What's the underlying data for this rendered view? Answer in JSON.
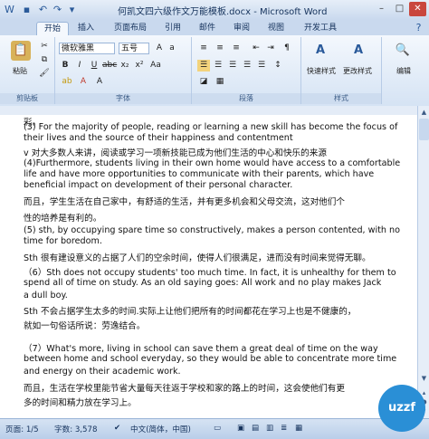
{
  "window": {
    "title": "何凯文四六级作文万能模板.docx - Microsoft Word"
  },
  "tabs": [
    "开始",
    "插入",
    "页面布局",
    "引用",
    "邮件",
    "审阅",
    "视图",
    "开发工具"
  ],
  "ribbon": {
    "clipboard": {
      "label": "剪贴板",
      "paste": "粘贴"
    },
    "font": {
      "label": "字体",
      "font_name": "微软雅黑",
      "font_size": "五号"
    },
    "paragraph": {
      "label": "段落"
    },
    "styles": {
      "label": "样式",
      "quick_styles": "快速样式",
      "change_styles": "更改样式"
    },
    "editing": {
      "label": "编辑"
    }
  },
  "document": {
    "lines": [
      "彩。",
      "(3) For the majority of people, reading or learning a new skill has become the focus of",
      "their lives and the source of their happiness and contentment",
      "v    对大多数人来讲，阅读或学习一项新技能已成为他们生活的中心和快乐的来源",
      "(4)Furthermore, students living in their own home would have access to a comfortable",
      "life and have more opportunities to communicate with their parents, which have",
      "beneficial impact on development of their personal character.",
      "      而且，学生生活在自己家中，有舒适的生活，并有更多机会和父母交流，这对他们个",
      "性的培养是有利的。",
      "(5) sth, by occupying spare time so constructively, makes a person contented, with no",
      "time for boredom.",
      "  Sth 很有建设意义的占据了人们的空余时间，使得人们很满足，进而没有时间来觉得无聊。",
      "（6）Sth does not occupy students' too much time. In fact, it is unhealthy for them to",
      "spend all of time on study. As an old saying goes: All work and no play makes Jack",
      "a dull boy.",
      "      Sth 不会占据学生太多的时间.实际上让他们把所有的时间都花在学习上也是不健康的，",
      "就如一句俗话所说：劳逸结合。",
      "",
      "（7）What's more, living in school can save them a great deal of time on the way",
      "between home and school everyday, so they would be able to concentrate more time",
      "and energy on their academic work.",
      "      而且，生活在学校里能节省大量每天往返于学校和家的路上的时间，这会使他们有更",
      "多的时间和精力放在学习上。"
    ]
  },
  "status": {
    "page": "页面: 1/5",
    "words": "字数: 3,578",
    "language": "中文(简体，中国)"
  },
  "watermark": "uzzf.com"
}
